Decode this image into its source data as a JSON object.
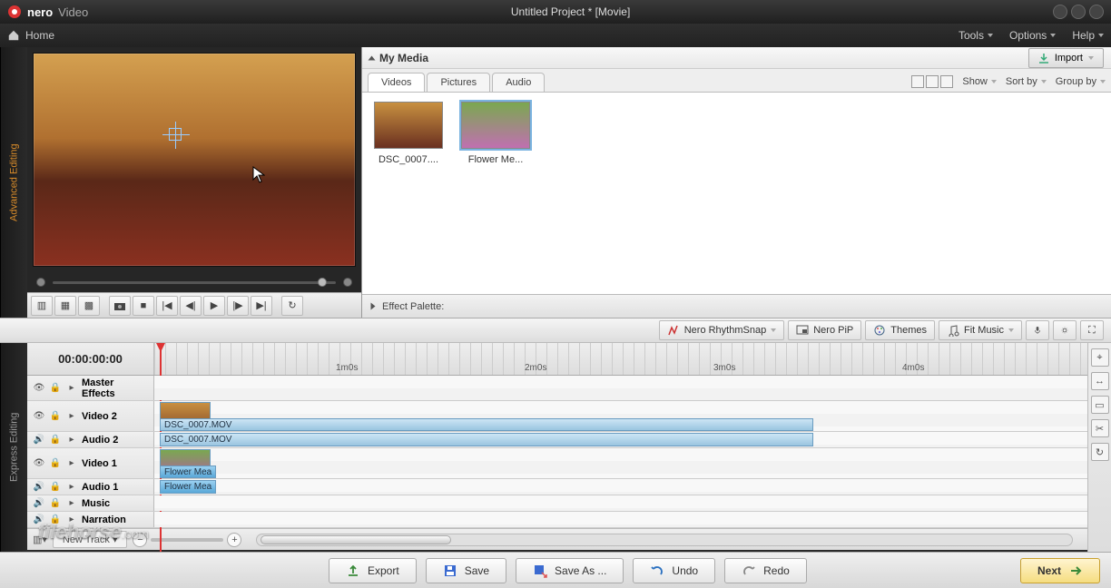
{
  "app": {
    "brand_bold": "nero",
    "brand_sub": "Video",
    "window_title": "Untitled Project * [Movie]"
  },
  "menubar": {
    "home": "Home",
    "tools": "Tools",
    "options": "Options",
    "help": "Help"
  },
  "sidetabs": {
    "advanced": "Advanced Editing",
    "express": "Express Editing"
  },
  "media": {
    "panel_title": "My Media",
    "import": "Import",
    "tabs": {
      "videos": "Videos",
      "pictures": "Pictures",
      "audio": "Audio"
    },
    "view": {
      "show": "Show",
      "sortby": "Sort by",
      "groupby": "Group by"
    },
    "items": [
      {
        "label": "DSC_0007....",
        "kind": "room"
      },
      {
        "label": "Flower Me...",
        "kind": "flower"
      }
    ]
  },
  "effect_palette": {
    "label": "Effect Palette:"
  },
  "timeline_toolbar": {
    "rhythm": "Nero RhythmSnap",
    "pip": "Nero PiP",
    "themes": "Themes",
    "fitmusic": "Fit Music"
  },
  "timeline": {
    "timecode": "00:00:00:00",
    "marks": [
      "1m0s",
      "2m0s",
      "3m0s",
      "4m0s"
    ],
    "tracks": {
      "master": "Master Effects",
      "video2": "Video 2",
      "audio2": "Audio 2",
      "video1": "Video 1",
      "audio1": "Audio 1",
      "music": "Music",
      "narration": "Narration"
    },
    "clips": {
      "dsc_label": "DSC_0007.MOV",
      "flower_label": "Flower Mea"
    },
    "newtrack": "New Track"
  },
  "actions": {
    "export": "Export",
    "save": "Save",
    "saveas": "Save As ...",
    "undo": "Undo",
    "redo": "Redo",
    "next": "Next"
  },
  "watermark": {
    "text": "filehorse",
    "suffix": ".com"
  }
}
